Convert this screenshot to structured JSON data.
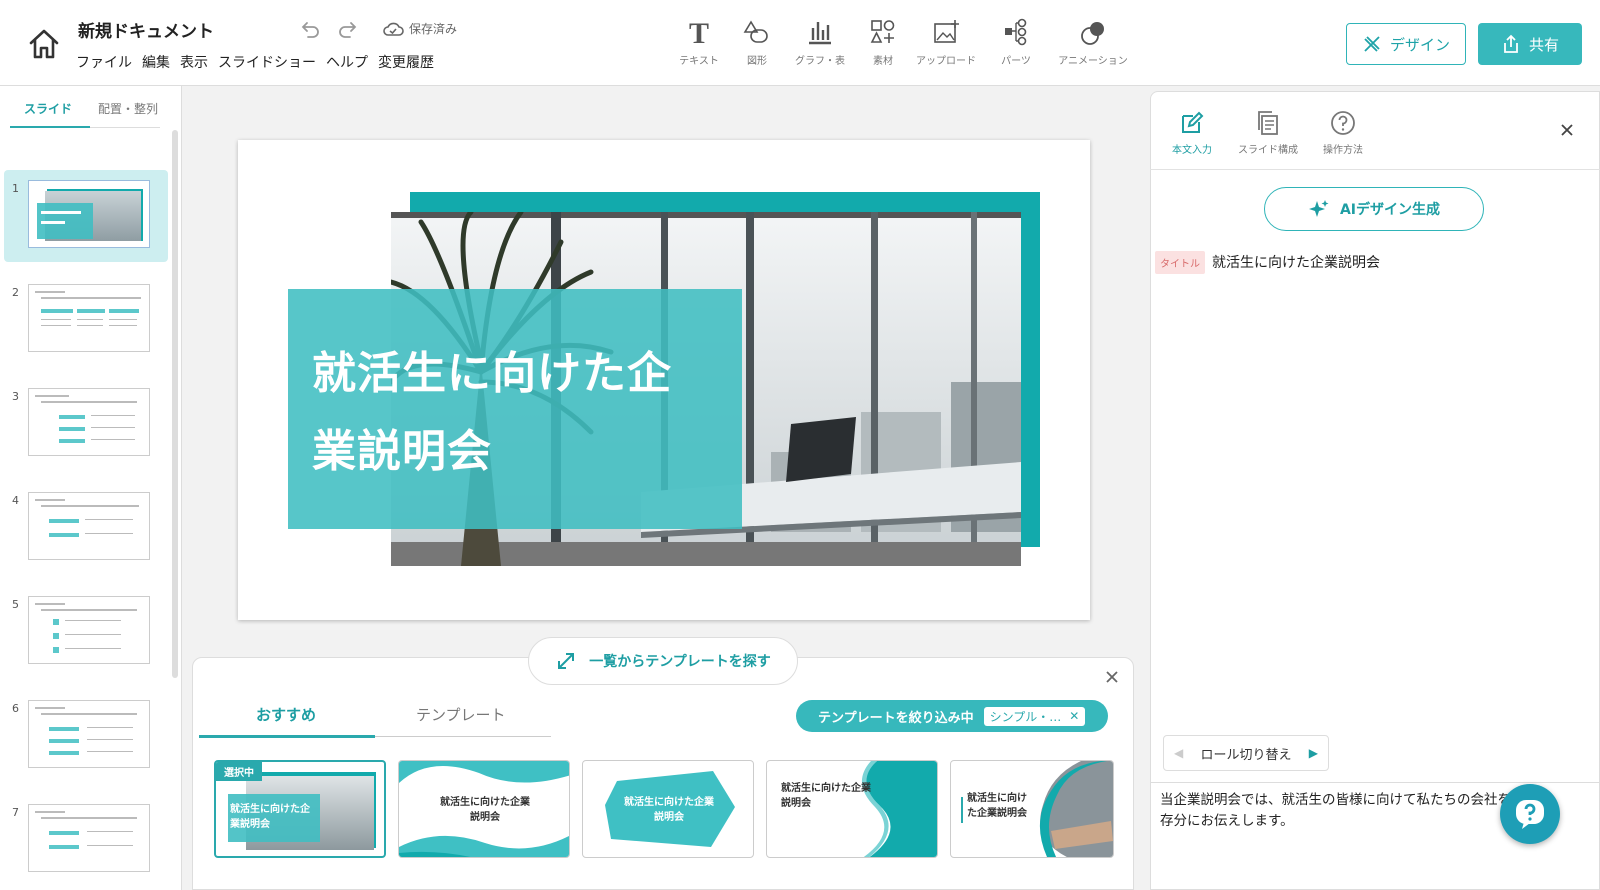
{
  "app": {
    "doc_title": "新規ドキュメント",
    "save_status": "保存済み"
  },
  "menu": [
    "ファイル",
    "編集",
    "表示",
    "スライドショー",
    "ヘルプ",
    "変更履歴"
  ],
  "toolbar": {
    "tools": [
      {
        "label": "テキスト",
        "icon": "text-icon"
      },
      {
        "label": "図形",
        "icon": "shapes-icon"
      },
      {
        "label": "グラフ・表",
        "icon": "chart-icon"
      },
      {
        "label": "素材",
        "icon": "assets-icon"
      },
      {
        "label": "アップロード",
        "icon": "upload-image-icon"
      },
      {
        "label": "パーツ",
        "icon": "parts-icon"
      },
      {
        "label": "アニメーション",
        "icon": "animation-icon"
      }
    ],
    "design_label": "デザイン",
    "share_label": "共有"
  },
  "left_panel": {
    "tabs": [
      "スライド",
      "配置・整列"
    ],
    "slide_numbers": [
      "1",
      "2",
      "3",
      "4",
      "5",
      "6",
      "7"
    ]
  },
  "slide": {
    "title_line1": "就活生に向けた企",
    "title_line2": "業説明会"
  },
  "template_panel": {
    "find_label": "一覧からテンプレートを探す",
    "tabs": [
      "おすすめ",
      "テンプレート"
    ],
    "filter_label": "テンプレートを絞り込み中",
    "filter_chip": "シンプル・…",
    "selected_badge": "選択中",
    "cards": [
      {
        "title": "就活生に向けた企\n業説明会"
      },
      {
        "title": "就活生に向けた企業\n説明会"
      },
      {
        "title": "就活生に向けた企業\n説明会"
      },
      {
        "title": "就活生に向けた企業\n説明会"
      },
      {
        "title": "就活生に向け\nた企業説明会"
      }
    ]
  },
  "right_panel": {
    "tabs": [
      "本文入力",
      "スライド構成",
      "操作方法"
    ],
    "ai_button": "AIデザイン生成",
    "title_tag": "タイトル",
    "title_text": "就活生に向けた企業説明会",
    "role_switch": "ロール切り替え",
    "body_line1": "当企業説明会では、就活生の皆様に向けて私たちの会社を",
    "body_line2": "存分にお伝えします。"
  },
  "colors": {
    "accent": "#37b8bc",
    "accent_dark": "#12aaac",
    "tag_bg": "#fbe1e1"
  }
}
